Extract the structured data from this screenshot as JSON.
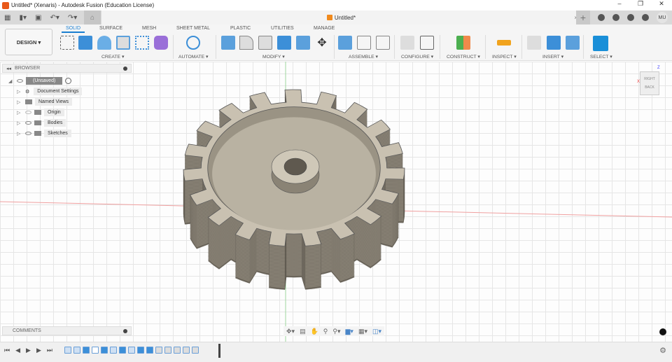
{
  "window": {
    "title": "Untitled* (Xenaris) - Autodesk Fusion (Education License)",
    "minimize": "–",
    "maximize": "❐",
    "close": "✕"
  },
  "doc_tab": {
    "label": "Untitled*",
    "close": "×"
  },
  "user": {
    "initials": "MU"
  },
  "workspace": {
    "label": "DESIGN ▾"
  },
  "ribbon_tabs": [
    "SOLID",
    "SURFACE",
    "MESH",
    "SHEET METAL",
    "PLASTIC",
    "UTILITIES",
    "MANAGE"
  ],
  "groups": [
    "CREATE ▾",
    "AUTOMATE ▾",
    "MODIFY ▾",
    "ASSEMBLE ▾",
    "CONFIGURE ▾",
    "CONSTRUCT ▾",
    "INSPECT ▾",
    "INSERT ▾",
    "SELECT ▾"
  ],
  "browser": {
    "title": "BROWSER",
    "root": "(Unsaved)",
    "items": [
      "Document Settings",
      "Named Views",
      "Origin",
      "Bodies",
      "Sketches"
    ]
  },
  "comments": {
    "title": "COMMENTS"
  },
  "viewcube": {
    "top": "RIGHT",
    "face": "BACK",
    "z": "Z",
    "x": "X"
  },
  "colors": {
    "accent": "#1a7fd0",
    "gear_top": "#c9c1b1",
    "gear_side": "#8d8679"
  }
}
